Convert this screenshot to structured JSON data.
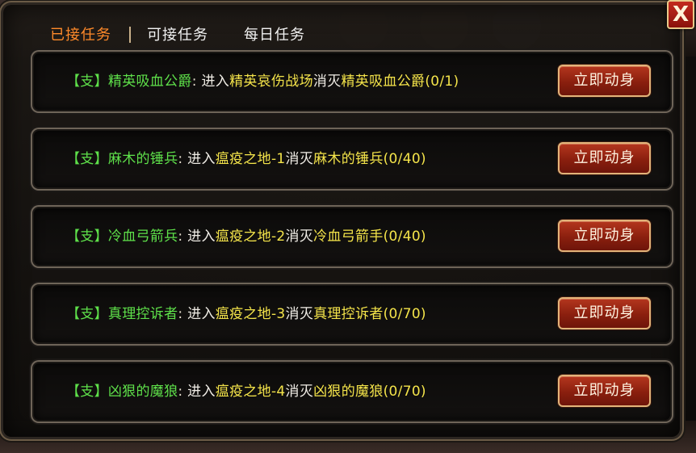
{
  "tabs": [
    {
      "label": "已接任务",
      "active": true
    },
    {
      "label": "可接任务",
      "active": false
    },
    {
      "label": "每日任务",
      "active": false
    }
  ],
  "close_label": "X",
  "button_label": "立即动身",
  "quests": [
    {
      "tag": "【支】",
      "name": "精英吸血公爵",
      "colon": ":",
      "enter": "进入",
      "location": "精英哀伤战场",
      "action": "消灭",
      "target": "精英吸血公爵",
      "progress": "(0/1)"
    },
    {
      "tag": "【支】",
      "name": "麻木的锤兵",
      "colon": ":",
      "enter": "进入",
      "location": "瘟疫之地-1",
      "action": "消灭",
      "target": "麻木的锤兵",
      "progress": "(0/40)"
    },
    {
      "tag": "【支】",
      "name": "冷血弓箭兵",
      "colon": ":",
      "enter": "进入",
      "location": "瘟疫之地-2",
      "action": "消灭",
      "target": "冷血弓箭手",
      "progress": "(0/40)"
    },
    {
      "tag": "【支】",
      "name": "真理控诉者",
      "colon": ":",
      "enter": "进入",
      "location": "瘟疫之地-3",
      "action": "消灭",
      "target": "真理控诉者",
      "progress": "(0/70)"
    },
    {
      "tag": "【支】",
      "name": "凶狠的魔狼",
      "colon": ":",
      "enter": "进入",
      "location": "瘟疫之地-4",
      "action": "消灭",
      "target": "凶狠的魔狼",
      "progress": "(0/70)"
    }
  ],
  "colors": {
    "active_tab": "#ff8a2a",
    "quest_name": "#5ee04a",
    "highlight": "#f4e44a",
    "button_bg": "#8a1f0e"
  }
}
